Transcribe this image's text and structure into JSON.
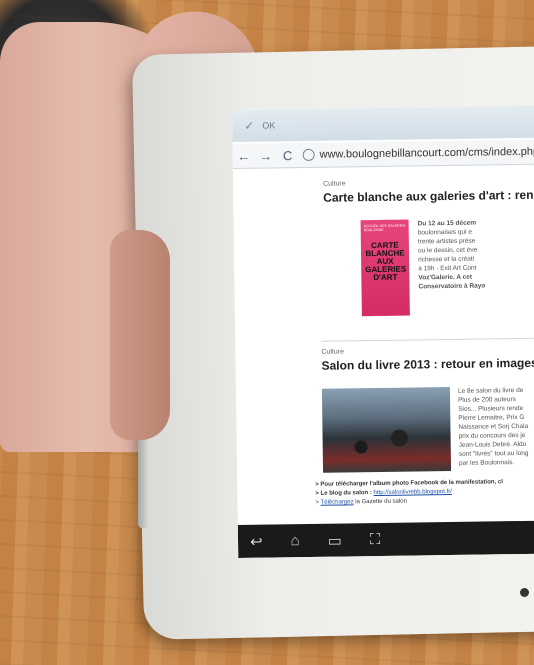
{
  "browser": {
    "status_text": "OK",
    "url": "www.boulognebillancourt.com/cms/index.php",
    "back_glyph": "←",
    "forward_glyph": "→",
    "refresh_glyph": "C"
  },
  "articles": [
    {
      "category": "Culture",
      "headline": "Carte blanche aux galeries d'art : rend",
      "body_lines": [
        "Du 12 au 15 décem",
        "boulonnaises qui e",
        "trente artistes prése",
        "ou le dessin, cet éve",
        "richesse et la créati",
        "à 19h · Exit Art Cont",
        "Voz'Galerie. A cet",
        "Conservatoire à Rayo"
      ],
      "poster": {
        "top_text": "ACCUEIL DES GALERIES BOULOGNE",
        "title": "CARTE BLANCHE AUX GALERIES D'ART"
      }
    },
    {
      "category": "Culture",
      "headline": "Salon du livre 2013 : retour en images !",
      "body_lines": [
        "Le 8e salon du livre de",
        "Plus de 200 auteurs",
        "Sios... Plusieurs rende",
        "Pierre Lemaitre, Prix G",
        "Naissance et Sorj Chala",
        "prix du concours des je",
        "Jean-Louis Debré. Aldo",
        "sont \"livrés\" tout au long",
        "par les Boulonnais."
      ]
    }
  ],
  "links": {
    "line1": "> Pour télécharger l'album photo Facebook de la manifestation, cl",
    "line2_prefix": "> Le blog du salon : ",
    "line2_link": "http://salonlivrebb.blogspot.fr/",
    "line3_prefix": "> ",
    "line3_link": "Téléchargez",
    "line3_suffix": " la Gazette du salon"
  },
  "android_nav": {
    "back": "↩",
    "home": "⌂",
    "recents": "▭",
    "screenshot": "⛶"
  }
}
